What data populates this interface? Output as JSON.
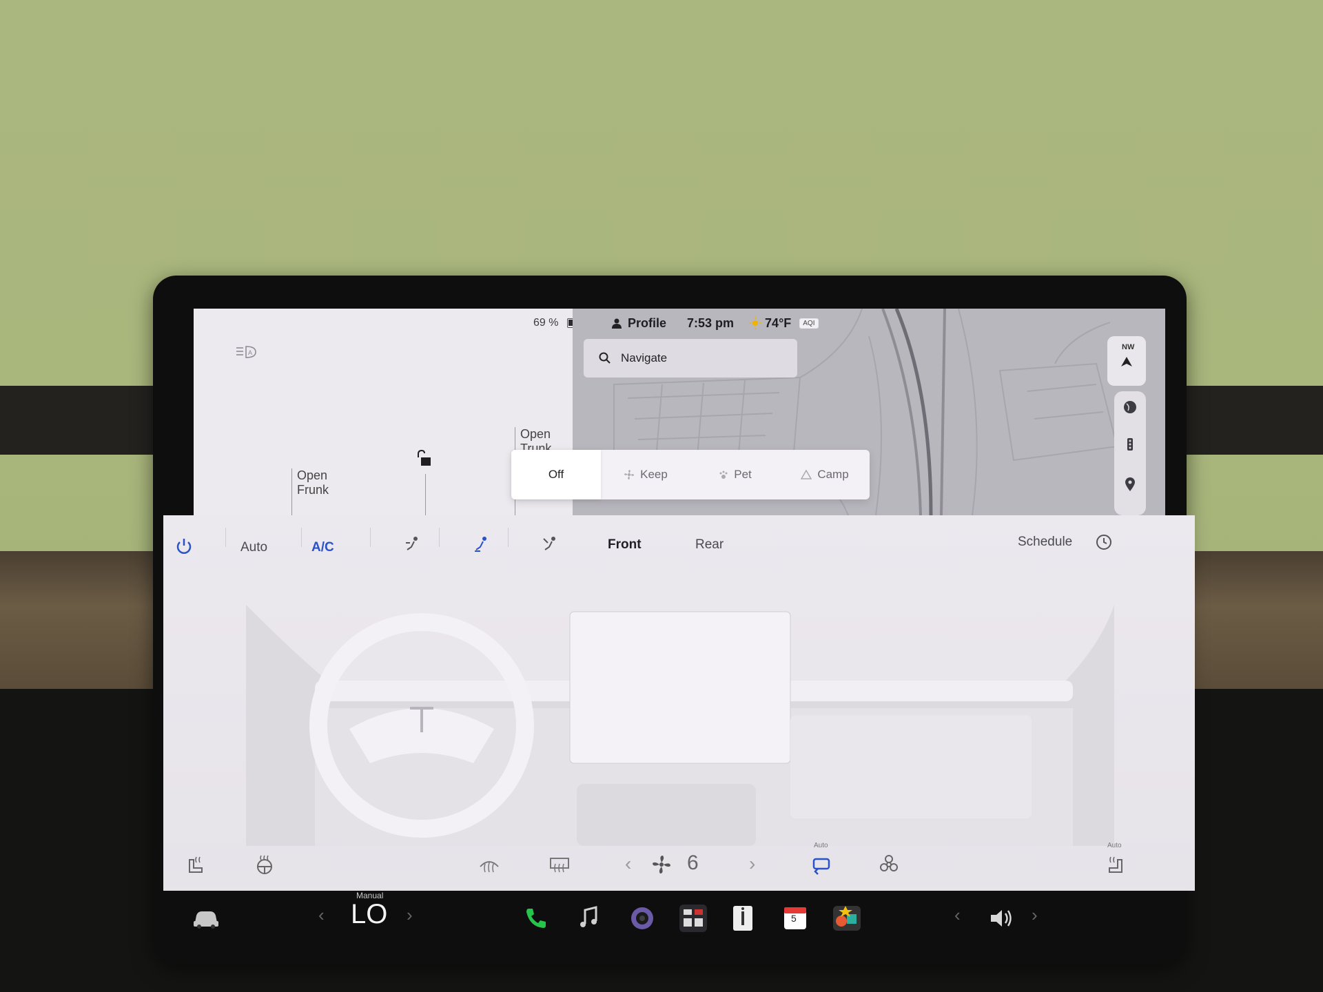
{
  "status_bar": {
    "battery_percent": "69 %",
    "battery_level": 0.69,
    "profile_label": "Profile",
    "time": "7:53 pm",
    "temperature": "74°F",
    "aqi_label": "AQI"
  },
  "car_panel": {
    "frunk_label_line1": "Open",
    "frunk_label_line2": "Frunk",
    "trunk_label_line1": "Open",
    "trunk_label_line2": "Trunk"
  },
  "map": {
    "navigate_placeholder": "Navigate",
    "compass_heading": "NW"
  },
  "climate_keeper": {
    "modes": [
      "Off",
      "Keep",
      "Pet",
      "Camp"
    ],
    "selected": "Off"
  },
  "climate": {
    "auto_label": "Auto",
    "ac_label": "A/C",
    "front_label": "Front",
    "rear_label": "Rear",
    "schedule_label": "Schedule",
    "fan_speed": "6",
    "recirc_auto_label": "Auto",
    "seat_heat_auto_label": "Auto"
  },
  "taskbar": {
    "temp_mode_label": "Manual",
    "temp_value": "LO",
    "calendar_day": "5"
  },
  "colors": {
    "accent_blue": "#2a52c8",
    "screen_bg": "#ebe8ee",
    "map_bg": "#b9b7be"
  }
}
